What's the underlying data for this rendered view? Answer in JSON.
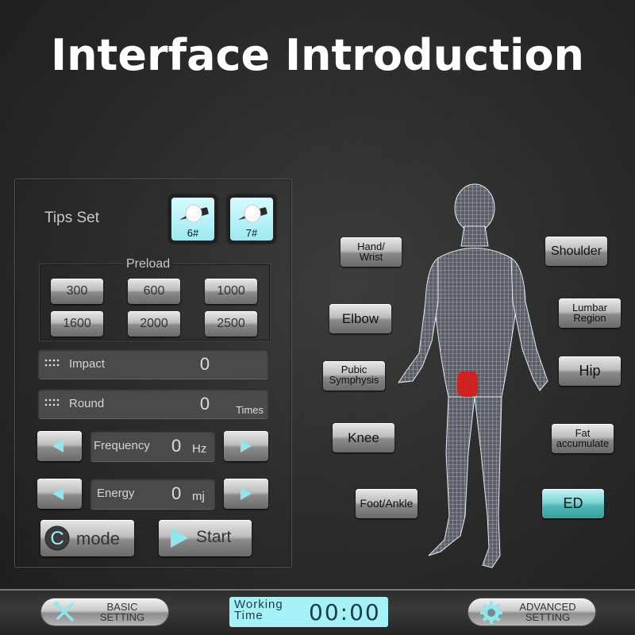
{
  "page_title": "Interface Introduction",
  "left_panel": {
    "tips": {
      "label": "Tips Set",
      "items": [
        {
          "label": "6#",
          "icon": "probe-tip-icon",
          "color": "#a9eef5"
        },
        {
          "label": "7#",
          "icon": "probe-tip-icon",
          "color": "#a9eef5"
        }
      ]
    },
    "preload": {
      "label": "Preload",
      "options": [
        "300",
        "600",
        "1000",
        "1600",
        "2000",
        "2500"
      ]
    },
    "impact": {
      "icon": "grip-dots-icon",
      "label": "Impact",
      "value": "0"
    },
    "round": {
      "icon": "grip-dots-icon",
      "label": "Round",
      "value": "0",
      "unit": "Times"
    },
    "frequency": {
      "label": "Frequency",
      "value": "0",
      "unit": "Hz",
      "decrease_icon": "triangle-left-icon",
      "increase_icon": "triangle-right-icon"
    },
    "energy": {
      "label": "Energy",
      "value": "0",
      "unit": "mj",
      "decrease_icon": "triangle-left-icon",
      "increase_icon": "triangle-right-icon"
    },
    "mode_button": {
      "icon_letter": "C",
      "label": "mode"
    },
    "start_button": {
      "icon": "play-icon",
      "label": "Start"
    }
  },
  "body_zones": {
    "left": [
      {
        "id": "hand-wrist",
        "lines": [
          "Hand/",
          "Wrist"
        ]
      },
      {
        "id": "elbow",
        "lines": [
          "Elbow"
        ]
      },
      {
        "id": "pubic-symphysis",
        "lines": [
          "Pubic",
          "Symphysis"
        ]
      },
      {
        "id": "knee",
        "lines": [
          "Knee"
        ]
      },
      {
        "id": "foot-ankle",
        "lines": [
          "Foot/Ankle"
        ]
      }
    ],
    "right": [
      {
        "id": "shoulder",
        "lines": [
          "Shoulder"
        ]
      },
      {
        "id": "lumbar-region",
        "lines": [
          "Lumbar",
          "Region"
        ]
      },
      {
        "id": "hip",
        "lines": [
          "Hip"
        ]
      },
      {
        "id": "fat-accumulate",
        "lines": [
          "Fat",
          "accumulate"
        ]
      },
      {
        "id": "ed",
        "lines": [
          "ED"
        ],
        "selected": true
      }
    ],
    "highlight_color": "#e01818",
    "active_color": "#6fcfcf"
  },
  "bottom_bar": {
    "basic_setting": {
      "icon": "wrench-screwdriver-icon",
      "line1": "BASIC",
      "line2": "SETTING"
    },
    "working_time": {
      "line1": "Working",
      "line2": "Time",
      "value": "00:00"
    },
    "advanced_setting": {
      "icon": "gear-icon",
      "line1": "ADVANCED",
      "line2": "SETTING"
    }
  }
}
